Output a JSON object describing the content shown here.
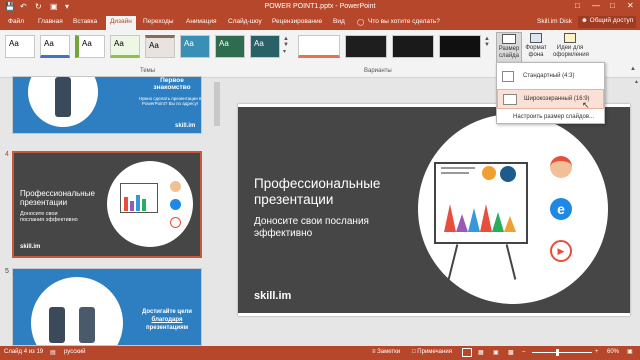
{
  "titlebar": {
    "title": "POWER POINT1.pptx - PowerPoint"
  },
  "tabs": [
    "Файл",
    "Главная",
    "Вставка",
    "Дизайн",
    "Переходы",
    "Анимация",
    "Слайд-шоу",
    "Рецензирование",
    "Вид"
  ],
  "active_tab": "Дизайн",
  "tellme": {
    "placeholder": "Что вы хотите сделать?"
  },
  "account": "Skill.im Disk",
  "share": "Общий доступ",
  "ribbon": {
    "themes_label": "Темы",
    "variants_label": "Варианты",
    "theme_sample": "Aa",
    "slide_size_label": "Размер слайда",
    "format_bg_label": "Формат фона",
    "ideas_label": "Идеи для оформления"
  },
  "dropdown": {
    "standard": "Стандартный (4:3)",
    "widescreen": "Широкоэкранный (16:9)",
    "custom": "Настроить размер слайдов..."
  },
  "thumbs": {
    "t3": {
      "title": "Первое знакомство",
      "text": "Нужно сделать презентации в PowerPoint? Вы по адресу!",
      "logo": "skill.im"
    },
    "t4": {
      "number": "4",
      "title": "Профессиональные презентации",
      "text": "Доносите свои послания эффективно",
      "logo": "skill.im"
    },
    "t5": {
      "number": "5",
      "title": "Достигайте цели",
      "link": "благодаря",
      "title2": "презентациям"
    }
  },
  "slide": {
    "title": "Профессиональные презентации",
    "subtitle": "Доносите свои послания эффективно",
    "logo": "skill.im"
  },
  "status": {
    "slide": "Слайд 4 из 19",
    "lang": "русский",
    "notes": "Заметки",
    "comments": "Примечания",
    "zoom": "60%"
  },
  "colors": {
    "accent": "#b7472a",
    "slide_bg": "#464646"
  }
}
